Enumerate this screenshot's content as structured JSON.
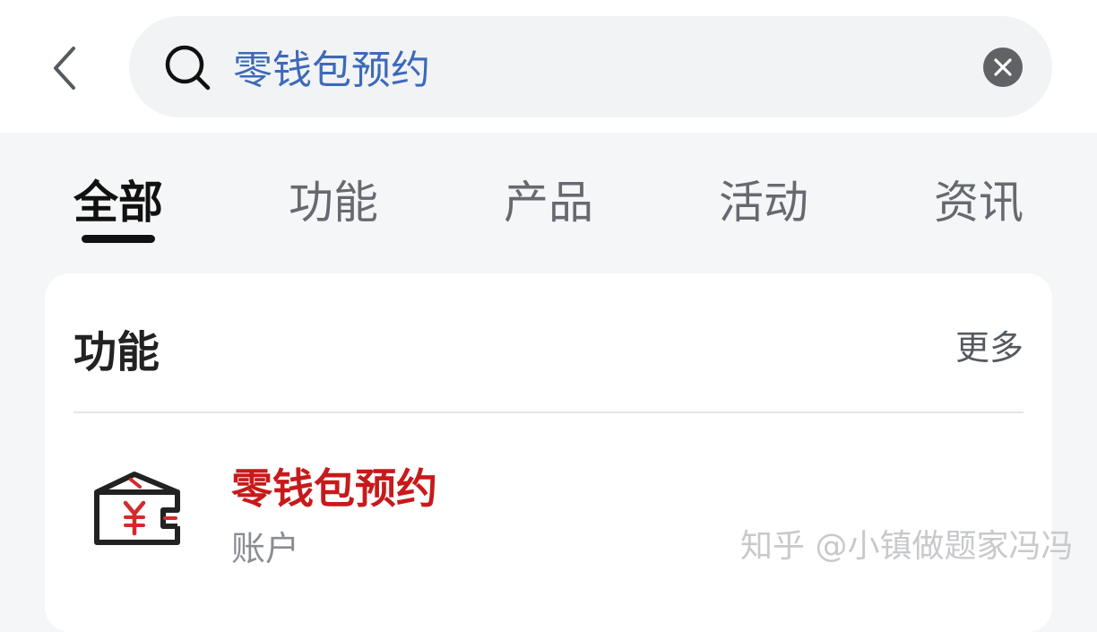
{
  "search": {
    "query": "零钱包预约"
  },
  "tabs": [
    {
      "label": "全部",
      "active": true
    },
    {
      "label": "功能",
      "active": false
    },
    {
      "label": "产品",
      "active": false
    },
    {
      "label": "活动",
      "active": false
    },
    {
      "label": "资讯",
      "active": false
    }
  ],
  "section": {
    "title": "功能",
    "more_label": "更多"
  },
  "results": [
    {
      "title": "零钱包预约",
      "subtitle": "账户",
      "icon": "wallet-yuan-icon"
    }
  ],
  "watermark": "知乎 @小镇做题家冯冯",
  "colors": {
    "query_text": "#3d6ab8",
    "result_title": "#c71a1a",
    "active_tab": "#111111",
    "inactive_tab": "#666a70"
  }
}
